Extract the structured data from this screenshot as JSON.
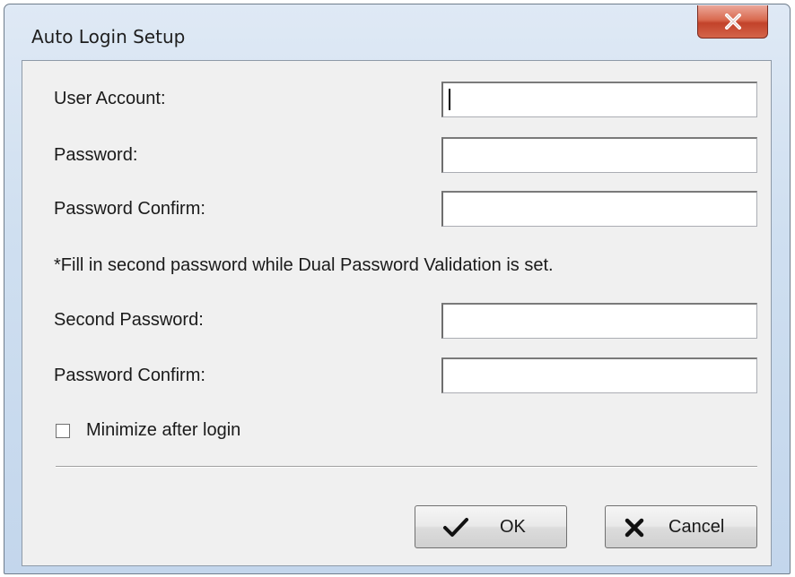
{
  "window": {
    "title": "Auto Login Setup",
    "close_icon": "close-icon"
  },
  "form": {
    "user_account_label": "User Account:",
    "user_account_value": "",
    "password_label": "Password:",
    "password_value": "",
    "password_confirm_label": "Password Confirm:",
    "password_confirm_value": "",
    "note": "*Fill in second password while Dual Password Validation is set.",
    "second_password_label": "Second Password:",
    "second_password_value": "",
    "second_password_confirm_label": "Password Confirm:",
    "second_password_confirm_value": "",
    "minimize_label": "Minimize after login",
    "minimize_checked": false
  },
  "buttons": {
    "ok_label": "OK",
    "ok_icon": "checkmark-icon",
    "cancel_label": "Cancel",
    "cancel_icon": "x-mark-icon"
  },
  "colors": {
    "close_button": "#c9452d",
    "titlebar": "#cfdff0",
    "client": "#f0f0f0"
  }
}
